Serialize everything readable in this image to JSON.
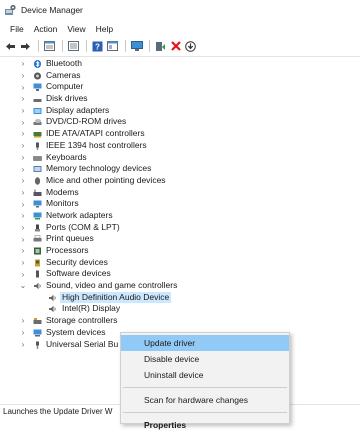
{
  "window": {
    "title": "Device Manager"
  },
  "menubar": {
    "items": [
      "File",
      "Action",
      "View",
      "Help"
    ]
  },
  "toolbar": {
    "icons": [
      "back-arrow-icon",
      "forward-arrow-icon",
      "properties-grid-icon",
      "help-book-icon",
      "show-hidden-icon",
      "help-icon",
      "console-tree-icon",
      "monitor-icon",
      "update-driver-icon",
      "uninstall-x-icon",
      "scan-download-icon"
    ]
  },
  "tree": {
    "categories": [
      {
        "label": "Bluetooth",
        "icon": "bluetooth-icon"
      },
      {
        "label": "Cameras",
        "icon": "camera-icon"
      },
      {
        "label": "Computer",
        "icon": "computer-icon"
      },
      {
        "label": "Disk drives",
        "icon": "disk-drive-icon"
      },
      {
        "label": "Display adapters",
        "icon": "display-adapter-icon"
      },
      {
        "label": "DVD/CD-ROM drives",
        "icon": "dvd-drive-icon"
      },
      {
        "label": "IDE ATA/ATAPI controllers",
        "icon": "ide-controller-icon"
      },
      {
        "label": "IEEE 1394 host controllers",
        "icon": "ieee1394-icon"
      },
      {
        "label": "Keyboards",
        "icon": "keyboard-icon"
      },
      {
        "label": "Memory technology devices",
        "icon": "memory-device-icon"
      },
      {
        "label": "Mice and other pointing devices",
        "icon": "mouse-icon"
      },
      {
        "label": "Modems",
        "icon": "modem-icon"
      },
      {
        "label": "Monitors",
        "icon": "monitor-icon"
      },
      {
        "label": "Network adapters",
        "icon": "network-adapter-icon"
      },
      {
        "label": "Ports (COM & LPT)",
        "icon": "port-icon"
      },
      {
        "label": "Print queues",
        "icon": "printer-icon"
      },
      {
        "label": "Processors",
        "icon": "processor-icon"
      },
      {
        "label": "Security devices",
        "icon": "security-device-icon"
      },
      {
        "label": "Software devices",
        "icon": "software-device-icon"
      },
      {
        "label": "Sound, video and game controllers",
        "icon": "speaker-icon",
        "expanded": true
      },
      {
        "label": "Storage controllers",
        "icon": "storage-controller-icon"
      },
      {
        "label": "System devices",
        "icon": "system-device-icon"
      },
      {
        "label": "Universal Serial Bus controllers",
        "icon": "usb-icon"
      }
    ],
    "sound_children": [
      {
        "label": "High Definition Audio Device",
        "icon": "speaker-icon",
        "selected": true
      },
      {
        "label": "Intel(R) Display Audio",
        "icon": "speaker-icon"
      }
    ],
    "visible_text": {
      "storage": "Storage controllers",
      "system": "System devices",
      "usb": "Universal Serial Bu",
      "hd_audio": "High Definition Audio Device",
      "intel_audio": "Intel(R) Display"
    }
  },
  "context_menu": {
    "items": [
      "Update driver",
      "Disable device",
      "Uninstall device",
      "Scan for hardware changes",
      "Properties"
    ],
    "highlighted": "Update driver",
    "default_item": "Properties"
  },
  "statusbar": {
    "text": "Launches the Update Driver W"
  },
  "colors": {
    "selection": "#cce8ff",
    "menu_highlight": "#91c9f7",
    "menu_bg": "#f2f2f2",
    "uninstall_red": "#e81123",
    "update_green": "#2e9e3a"
  }
}
